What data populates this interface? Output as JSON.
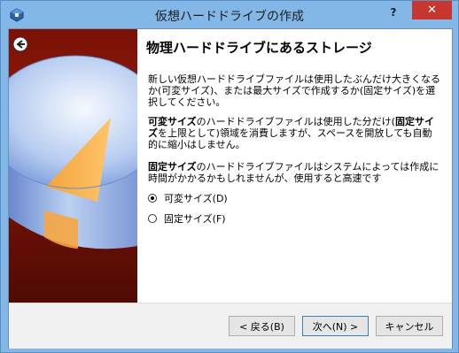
{
  "window": {
    "title": "仮想ハードドライブの作成",
    "help_label": "?",
    "close_label": "✕"
  },
  "page": {
    "heading": "物理ハードドライブにあるストレージ",
    "intro": "新しい仮想ハードドライブファイルは使用したぶんだけ大きくなるか(可変サイズ)、または最大サイズで作成するか(固定サイズ)を選択してください。",
    "dynamic_desc": {
      "term1": "可変サイズ",
      "text1": "のハードドライブファイルは使用した分だけ(",
      "term2": "固定サイズ",
      "text2": "を上限として)領域を消費しますが、スペースを開放しても自動的に縮小はしません。"
    },
    "fixed_desc": {
      "term": "固定サイズ",
      "text": "のハードドライブファイルはシステムによっては作成に時間がかかるかもしれませんが、使用すると高速です"
    },
    "options": [
      {
        "label": "可変サイズ(D)",
        "checked": true
      },
      {
        "label": "固定サイズ(F)",
        "checked": false
      }
    ]
  },
  "buttons": {
    "back": "< 戻る(B)",
    "next": "次へ(N) >",
    "cancel": "キャンセル"
  },
  "icons": {
    "app": "virtualbox-icon",
    "back": "back-arrow-icon"
  },
  "colors": {
    "accent": "#c7372f",
    "titlebar": "#82b7e8",
    "sidebar": "#7a1206"
  }
}
